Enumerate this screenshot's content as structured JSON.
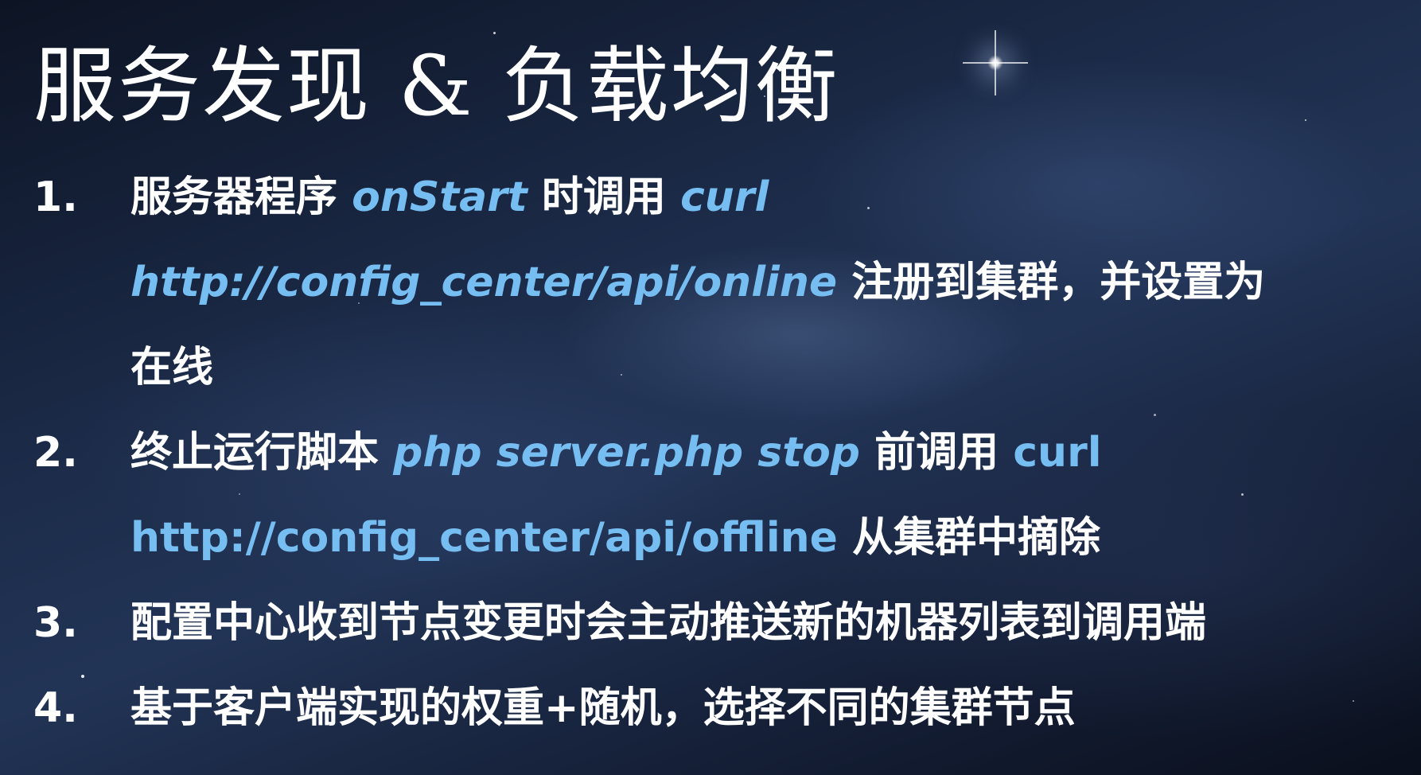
{
  "slide": {
    "title": "服务发现 & 负载均衡",
    "accent_color": "#76bef2",
    "items": [
      {
        "number": "1.",
        "l1_a": "服务器程序 ",
        "l1_b": "onStart",
        "l1_c": " 时调用 ",
        "l1_d": "curl",
        "l2_a": "http://config_center/api/online",
        "l2_b": " 注册到集群，并设置为",
        "l3_a": "在线"
      },
      {
        "number": "2.",
        "l1_a": "终止运行脚本 ",
        "l1_b": "php server.php stop",
        "l1_c": " 前调用 ",
        "l1_d": "curl",
        "l2_a": "http://config_center/api/offline",
        "l2_b": " 从集群中摘除"
      },
      {
        "number": "3.",
        "l1_a": "配置中心收到节点变更时会主动推送新的机器列表到调用端"
      },
      {
        "number": "4.",
        "l1_a": "基于客户端实现的权重+随机，选择不同的集群节点"
      }
    ]
  }
}
